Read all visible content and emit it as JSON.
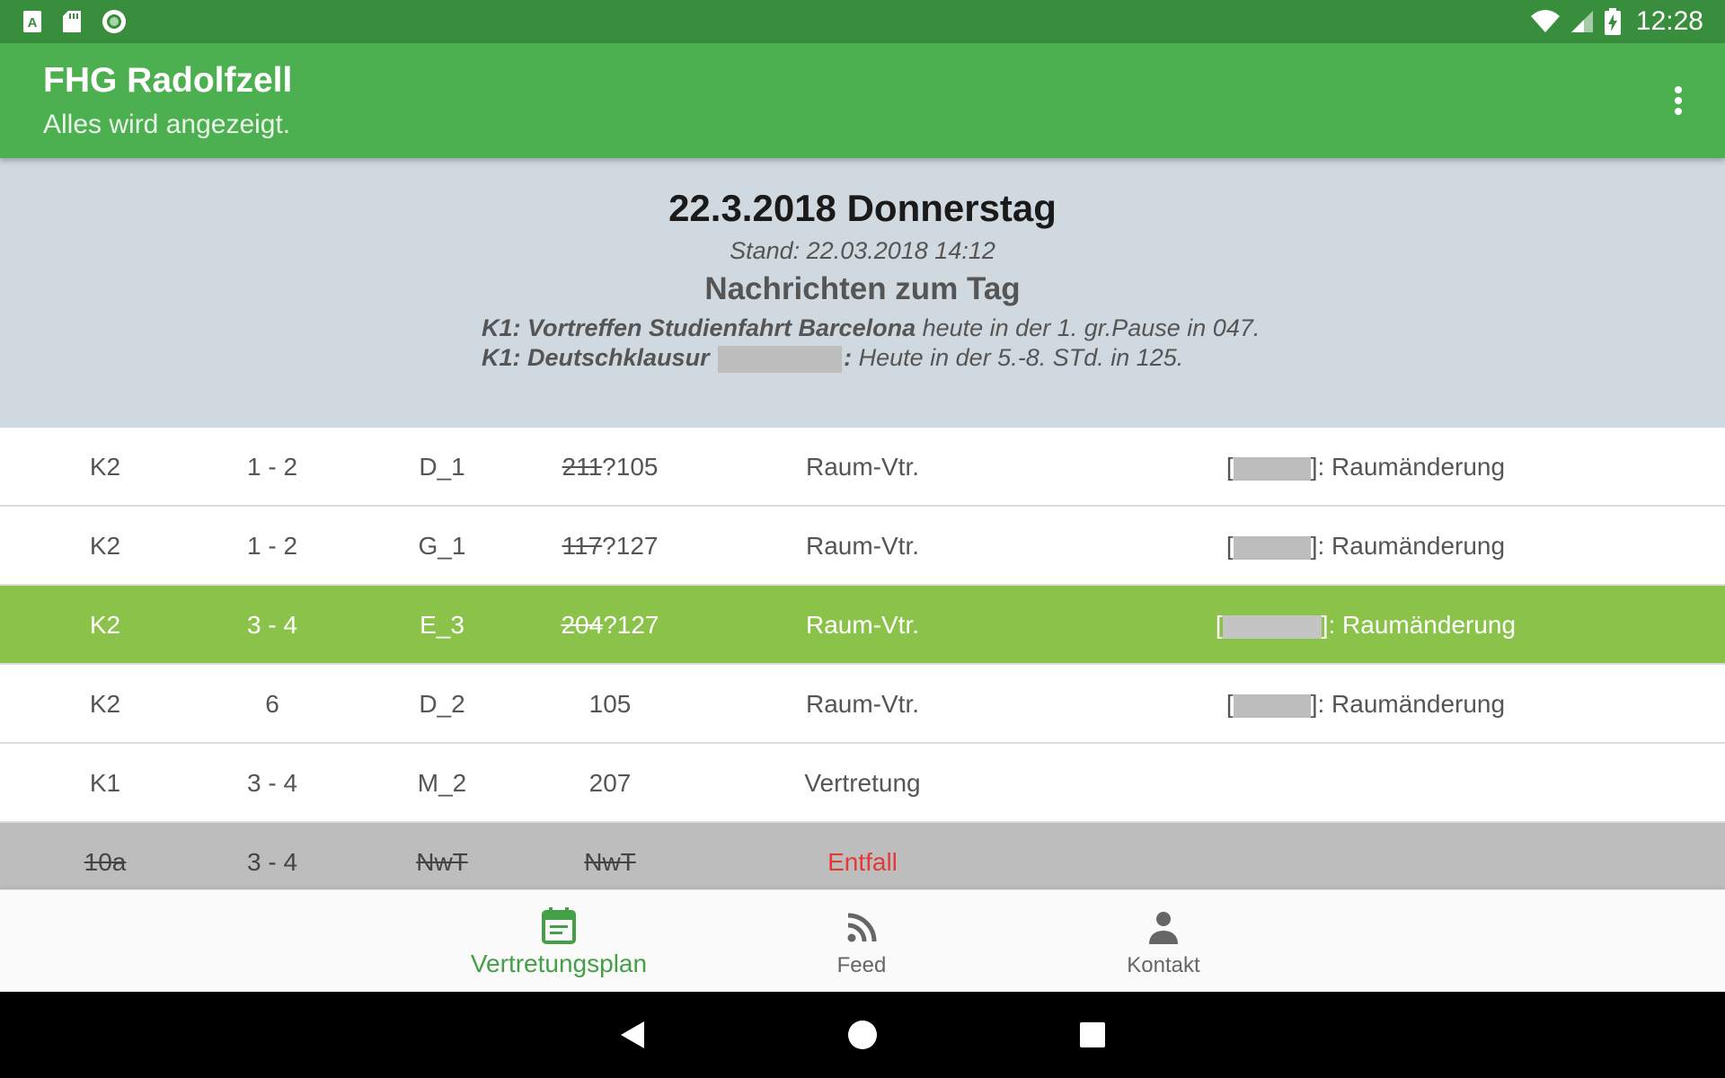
{
  "status_bar": {
    "time": "12:28",
    "icons_left": [
      "app-a-icon",
      "sd-card-icon",
      "sync-icon"
    ],
    "icons_right": [
      "wifi-icon",
      "signal-icon",
      "battery-charging-icon"
    ]
  },
  "app_bar": {
    "title": "FHG Radolfzell",
    "subtitle": "Alles wird angezeigt.",
    "menu_icon": "more-vert-icon"
  },
  "day": {
    "title": "22.3.2018 Donnerstag",
    "stand": "Stand: 22.03.2018 14:12",
    "news_title": "Nachrichten zum Tag",
    "news": [
      {
        "bold": "K1: Vortreffen Studienfahrt Barcelona",
        "text": " heute in der 1. gr.Pause in 047."
      },
      {
        "bold": "K1: Deutschklausur",
        "redacted": true,
        "bold_suffix": ":",
        "text": " Heute in der 5.-8. STd. in 125."
      }
    ]
  },
  "rows": [
    {
      "class": "K2",
      "lesson": "1 - 2",
      "subject": "D_1",
      "room_old": "211",
      "room_sep": "?",
      "room_new": "105",
      "type": "Raum-Vtr.",
      "info_open": "[",
      "info_close": "]: Raumänderung",
      "style": "normal"
    },
    {
      "class": "K2",
      "lesson": "1 - 2",
      "subject": "G_1",
      "room_old": "117",
      "room_sep": "?",
      "room_new": "127",
      "type": "Raum-Vtr.",
      "info_open": "[",
      "info_close": "]: Raumänderung",
      "style": "normal"
    },
    {
      "class": "K2",
      "lesson": "3 - 4",
      "subject": "E_3",
      "room_old": "204",
      "room_sep": "?",
      "room_new": "127",
      "type": "Raum-Vtr.",
      "info_open": "[",
      "info_close": "]: Raumänderung",
      "style": "highlight"
    },
    {
      "class": "K2",
      "lesson": "6",
      "subject": "D_2",
      "room_old": "",
      "room_sep": "",
      "room_new": "105",
      "type": "Raum-Vtr.",
      "info_open": "[",
      "info_close": "]: Raumänderung",
      "style": "normal"
    },
    {
      "class": "K1",
      "lesson": "3 - 4",
      "subject": "M_2",
      "room_old": "",
      "room_sep": "",
      "room_new": "207",
      "type": "Vertretung",
      "info_open": "",
      "info_close": "",
      "style": "normal"
    },
    {
      "class": "10a",
      "lesson": "3 - 4",
      "subject": "NwT",
      "room_old": "NwT",
      "room_sep": "",
      "room_new": "",
      "type": "Entfall",
      "info_open": "",
      "info_close": "",
      "style": "cancelled"
    }
  ],
  "bottom_nav": [
    {
      "label": "Vertretungsplan",
      "icon": "calendar-icon",
      "active": true
    },
    {
      "label": "Feed",
      "icon": "rss-feed-icon",
      "active": false
    },
    {
      "label": "Kontakt",
      "icon": "person-icon",
      "active": false
    }
  ],
  "colors": {
    "status_bar": "#388e3c",
    "app_bar": "#4caf50",
    "header_bg": "#d0d9df",
    "highlight_row": "#8bc34a",
    "cancelled_row": "#bdbdbd",
    "entfall_text": "#e53935",
    "nav_active": "#43a047"
  }
}
